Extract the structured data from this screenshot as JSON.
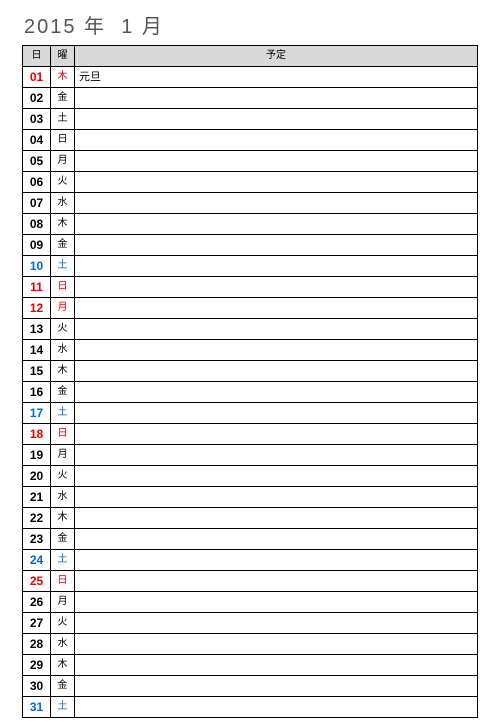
{
  "title": {
    "year": "2015",
    "year_unit": "年",
    "month": "1",
    "month_unit": "月"
  },
  "headers": {
    "day": "日",
    "dow": "曜",
    "plan": "予定"
  },
  "rows": [
    {
      "day": "01",
      "dow": "木",
      "plan": "元旦",
      "day_color": "red",
      "dow_color": "red"
    },
    {
      "day": "02",
      "dow": "金",
      "plan": "",
      "day_color": "",
      "dow_color": ""
    },
    {
      "day": "03",
      "dow": "土",
      "plan": "",
      "day_color": "",
      "dow_color": ""
    },
    {
      "day": "04",
      "dow": "日",
      "plan": "",
      "day_color": "",
      "dow_color": ""
    },
    {
      "day": "05",
      "dow": "月",
      "plan": "",
      "day_color": "",
      "dow_color": ""
    },
    {
      "day": "06",
      "dow": "火",
      "plan": "",
      "day_color": "",
      "dow_color": ""
    },
    {
      "day": "07",
      "dow": "水",
      "plan": "",
      "day_color": "",
      "dow_color": ""
    },
    {
      "day": "08",
      "dow": "木",
      "plan": "",
      "day_color": "",
      "dow_color": ""
    },
    {
      "day": "09",
      "dow": "金",
      "plan": "",
      "day_color": "",
      "dow_color": ""
    },
    {
      "day": "10",
      "dow": "土",
      "plan": "",
      "day_color": "blue",
      "dow_color": "blue"
    },
    {
      "day": "11",
      "dow": "日",
      "plan": "",
      "day_color": "red",
      "dow_color": "red"
    },
    {
      "day": "12",
      "dow": "月",
      "plan": "",
      "day_color": "red",
      "dow_color": "red"
    },
    {
      "day": "13",
      "dow": "火",
      "plan": "",
      "day_color": "",
      "dow_color": ""
    },
    {
      "day": "14",
      "dow": "水",
      "plan": "",
      "day_color": "",
      "dow_color": ""
    },
    {
      "day": "15",
      "dow": "木",
      "plan": "",
      "day_color": "",
      "dow_color": ""
    },
    {
      "day": "16",
      "dow": "金",
      "plan": "",
      "day_color": "",
      "dow_color": ""
    },
    {
      "day": "17",
      "dow": "土",
      "plan": "",
      "day_color": "blue",
      "dow_color": "blue"
    },
    {
      "day": "18",
      "dow": "日",
      "plan": "",
      "day_color": "red",
      "dow_color": "red"
    },
    {
      "day": "19",
      "dow": "月",
      "plan": "",
      "day_color": "",
      "dow_color": ""
    },
    {
      "day": "20",
      "dow": "火",
      "plan": "",
      "day_color": "",
      "dow_color": ""
    },
    {
      "day": "21",
      "dow": "水",
      "plan": "",
      "day_color": "",
      "dow_color": ""
    },
    {
      "day": "22",
      "dow": "木",
      "plan": "",
      "day_color": "",
      "dow_color": ""
    },
    {
      "day": "23",
      "dow": "金",
      "plan": "",
      "day_color": "",
      "dow_color": ""
    },
    {
      "day": "24",
      "dow": "土",
      "plan": "",
      "day_color": "blue",
      "dow_color": "blue"
    },
    {
      "day": "25",
      "dow": "日",
      "plan": "",
      "day_color": "red",
      "dow_color": "red"
    },
    {
      "day": "26",
      "dow": "月",
      "plan": "",
      "day_color": "",
      "dow_color": ""
    },
    {
      "day": "27",
      "dow": "火",
      "plan": "",
      "day_color": "",
      "dow_color": ""
    },
    {
      "day": "28",
      "dow": "水",
      "plan": "",
      "day_color": "",
      "dow_color": ""
    },
    {
      "day": "29",
      "dow": "木",
      "plan": "",
      "day_color": "",
      "dow_color": ""
    },
    {
      "day": "30",
      "dow": "金",
      "plan": "",
      "day_color": "",
      "dow_color": ""
    },
    {
      "day": "31",
      "dow": "土",
      "plan": "",
      "day_color": "blue",
      "dow_color": "blue"
    }
  ]
}
